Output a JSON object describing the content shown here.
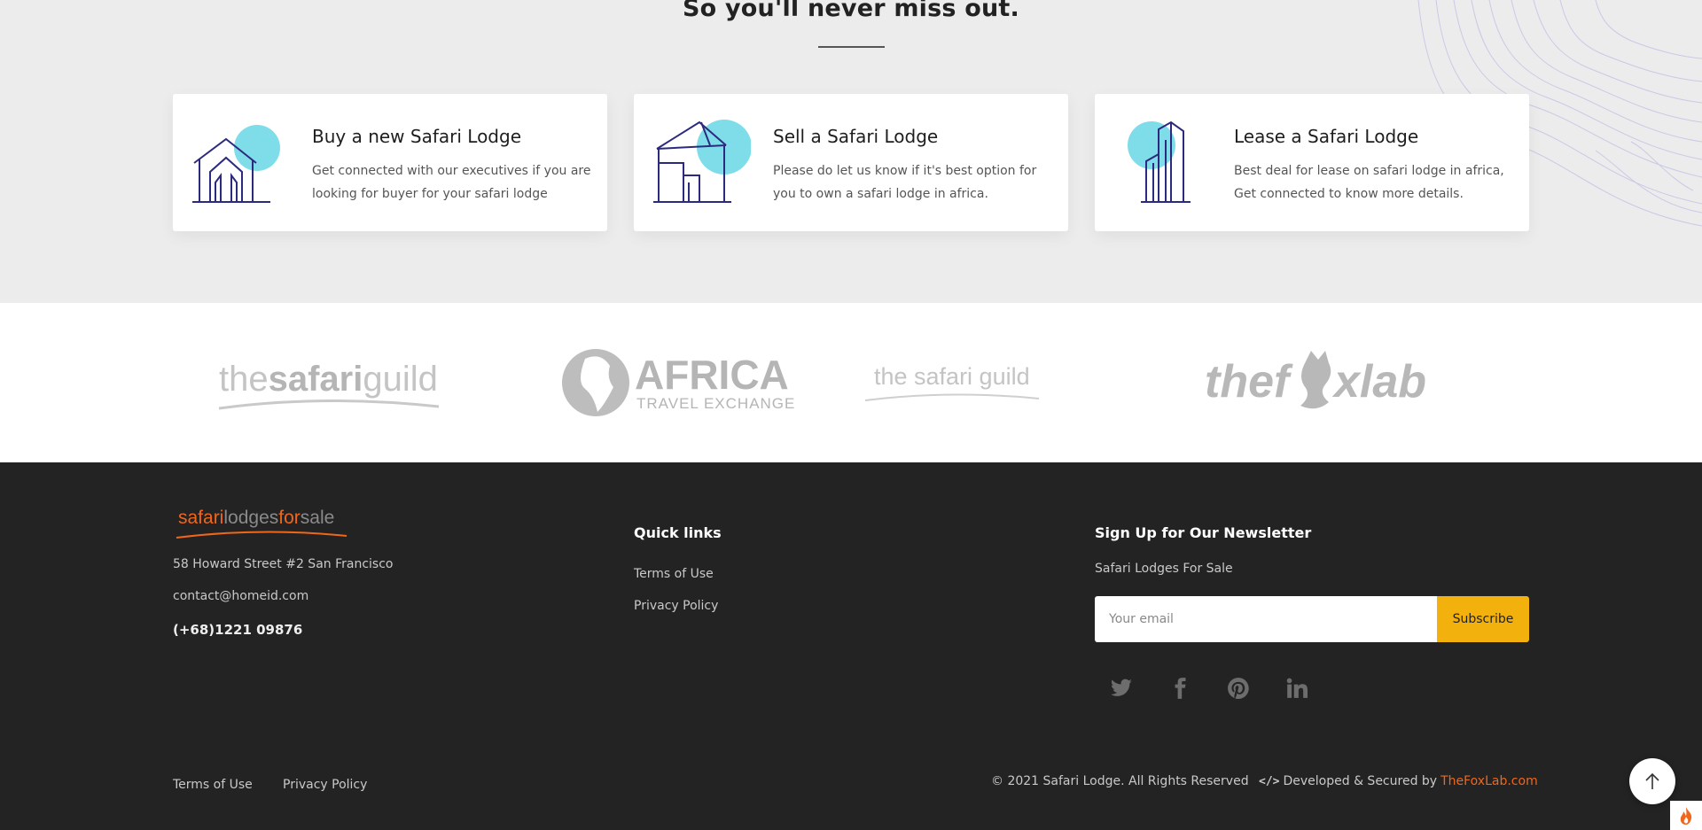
{
  "services": {
    "heading": "So you'll never miss out.",
    "cards": [
      {
        "icon": "house-icon",
        "title": "Buy a new Safari Lodge",
        "description": "Get connected with our executives if you are looking for buyer for your safari lodge"
      },
      {
        "icon": "building-icon",
        "title": "Sell a Safari Lodge",
        "description": "Please do let us know if it's best option for you to own a safari lodge in africa."
      },
      {
        "icon": "tower-icon",
        "title": "Lease a Safari Lodge",
        "description": "Best deal for lease on safari lodge in africa, Get connected to know more details."
      }
    ],
    "accent_color": "#7fdde9",
    "line_color": "#2c2a7e"
  },
  "partners": [
    {
      "name": "thesafariguild",
      "part1": "the",
      "part2": "safari",
      "part3": "guild"
    },
    {
      "name": "africa-travel-exchange",
      "line1": "AFRICA",
      "line2": "TRAVEL EXCHANGE"
    },
    {
      "name": "the-safari-guild-light",
      "text": "the safari guild"
    },
    {
      "name": "thefoxlab",
      "part1": "thef",
      "part2": "xlab"
    }
  ],
  "footer": {
    "logo": {
      "part1": "safari",
      "part2": "lodges",
      "part3": "for",
      "part4": "sale"
    },
    "address": "58 Howard Street #2 San Francisco",
    "email": "contact@homeid.com",
    "phone": "(+68)1221 09876",
    "quick_links": {
      "title": "Quick links",
      "items": [
        "Terms of Use",
        "Privacy Policy"
      ]
    },
    "newsletter": {
      "title": "Sign Up for Our Newsletter",
      "subtitle": "Safari Lodges For Sale",
      "placeholder": "Your email",
      "button": "Subscribe"
    },
    "socials": [
      "twitter-icon",
      "facebook-icon",
      "pinterest-icon",
      "linkedin-icon"
    ],
    "bottom_links": [
      "Terms of Use",
      "Privacy Policy"
    ],
    "copyright": "© 2021 Safari Lodge. All Rights Reserved",
    "dev_prefix": "Developed & Secured by",
    "dev_link": "TheFoxLab.com",
    "accent_color": "#f0661a",
    "button_color": "#f2b10c"
  }
}
